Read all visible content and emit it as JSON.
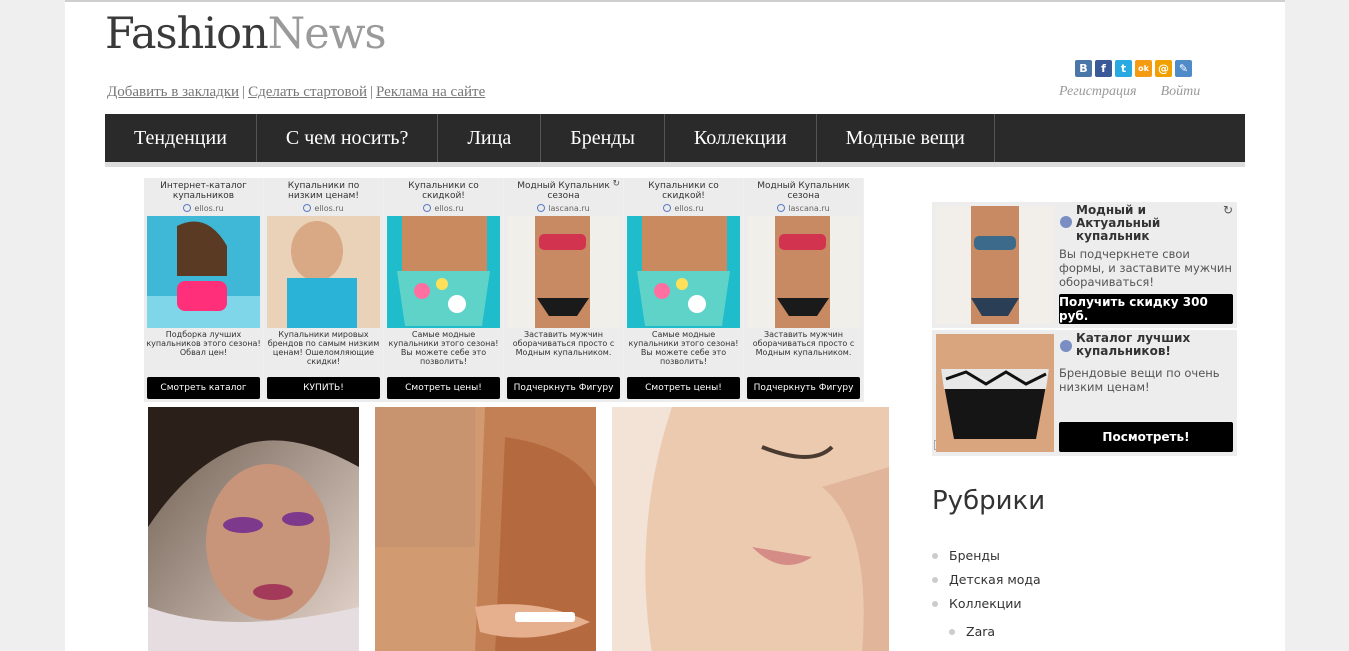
{
  "logo": {
    "part1": "Fashion",
    "part2": "News"
  },
  "toplinks": [
    "Добавить в закладки",
    "Сделать стартовой",
    "Реклама на сайте"
  ],
  "social": [
    {
      "icon": "vk-icon",
      "glyph": "B",
      "color": "#4a76a8"
    },
    {
      "icon": "facebook-icon",
      "glyph": "f",
      "color": "#3b5998"
    },
    {
      "icon": "twitter-icon",
      "glyph": "t",
      "color": "#29a9e1"
    },
    {
      "icon": "odnoklassniki-icon",
      "glyph": "ok",
      "color": "#f59a13"
    },
    {
      "icon": "mailru-icon",
      "glyph": "@",
      "color": "#f0a000"
    },
    {
      "icon": "livejournal-icon",
      "glyph": "✎",
      "color": "#4f8ac9"
    }
  ],
  "auth": {
    "register": "Регистрация",
    "login": "Войти"
  },
  "nav": [
    "Тенденции",
    "С чем носить?",
    "Лица",
    "Бренды",
    "Коллекции",
    "Модные вещи"
  ],
  "ads": [
    {
      "title": "Интернет-каталог купальников",
      "domain": "ellos.ru",
      "desc": "Подборка лучших купальников этого сезона! Обвал цен!",
      "button": "Смотреть каталог",
      "img": "woman-pink"
    },
    {
      "title": "Купальники по низким ценам!",
      "domain": "ellos.ru",
      "desc": "Купальники мировых брендов по самым низким ценам! Ошеломляющие скидки!",
      "button": "КУПИТЬ!",
      "img": "woman-blue"
    },
    {
      "title": "Купальники со скидкой!",
      "domain": "ellos.ru",
      "desc": "Самые модные купальники этого сезона! Вы можете себе это позволить!",
      "button": "Смотреть цены!",
      "img": "bottoms-floral"
    },
    {
      "title": "Модный Купальник сезона",
      "domain": "lascana.ru",
      "desc": "Заставить мужчин оборачиваться просто с Модным купальником.",
      "button": "Подчеркнуть Фигуру",
      "img": "bikini-dark"
    },
    {
      "title": "Купальники со скидкой!",
      "domain": "ellos.ru",
      "desc": "Самые модные купальники этого сезона! Вы можете себе это позволить!",
      "button": "Смотреть цены!",
      "img": "bottoms-floral"
    },
    {
      "title": "Модный Купальник сезона",
      "domain": "lascana.ru",
      "desc": "Заставить мужчин оборачиваться просто с Модным купальником.",
      "button": "Подчеркнуть Фигуру",
      "img": "bikini-dark"
    }
  ],
  "sideads": [
    {
      "title": "Модный и Актуальный купальник",
      "desc": "Вы подчеркнете свои формы, и заставите мужчин оборачиваться!",
      "button": "Получить скидку 300 руб."
    },
    {
      "title": "Каталог лучших купальников!",
      "desc": "Брендовые вещи по очень низким ценам!",
      "button": "Посмотреть!"
    }
  ],
  "rubrics": {
    "title": "Рубрики",
    "items": [
      {
        "label": "Бренды",
        "sub": false
      },
      {
        "label": "Детская мода",
        "sub": false
      },
      {
        "label": "Коллекции",
        "sub": false
      },
      {
        "label": "Zara",
        "sub": true
      }
    ]
  }
}
